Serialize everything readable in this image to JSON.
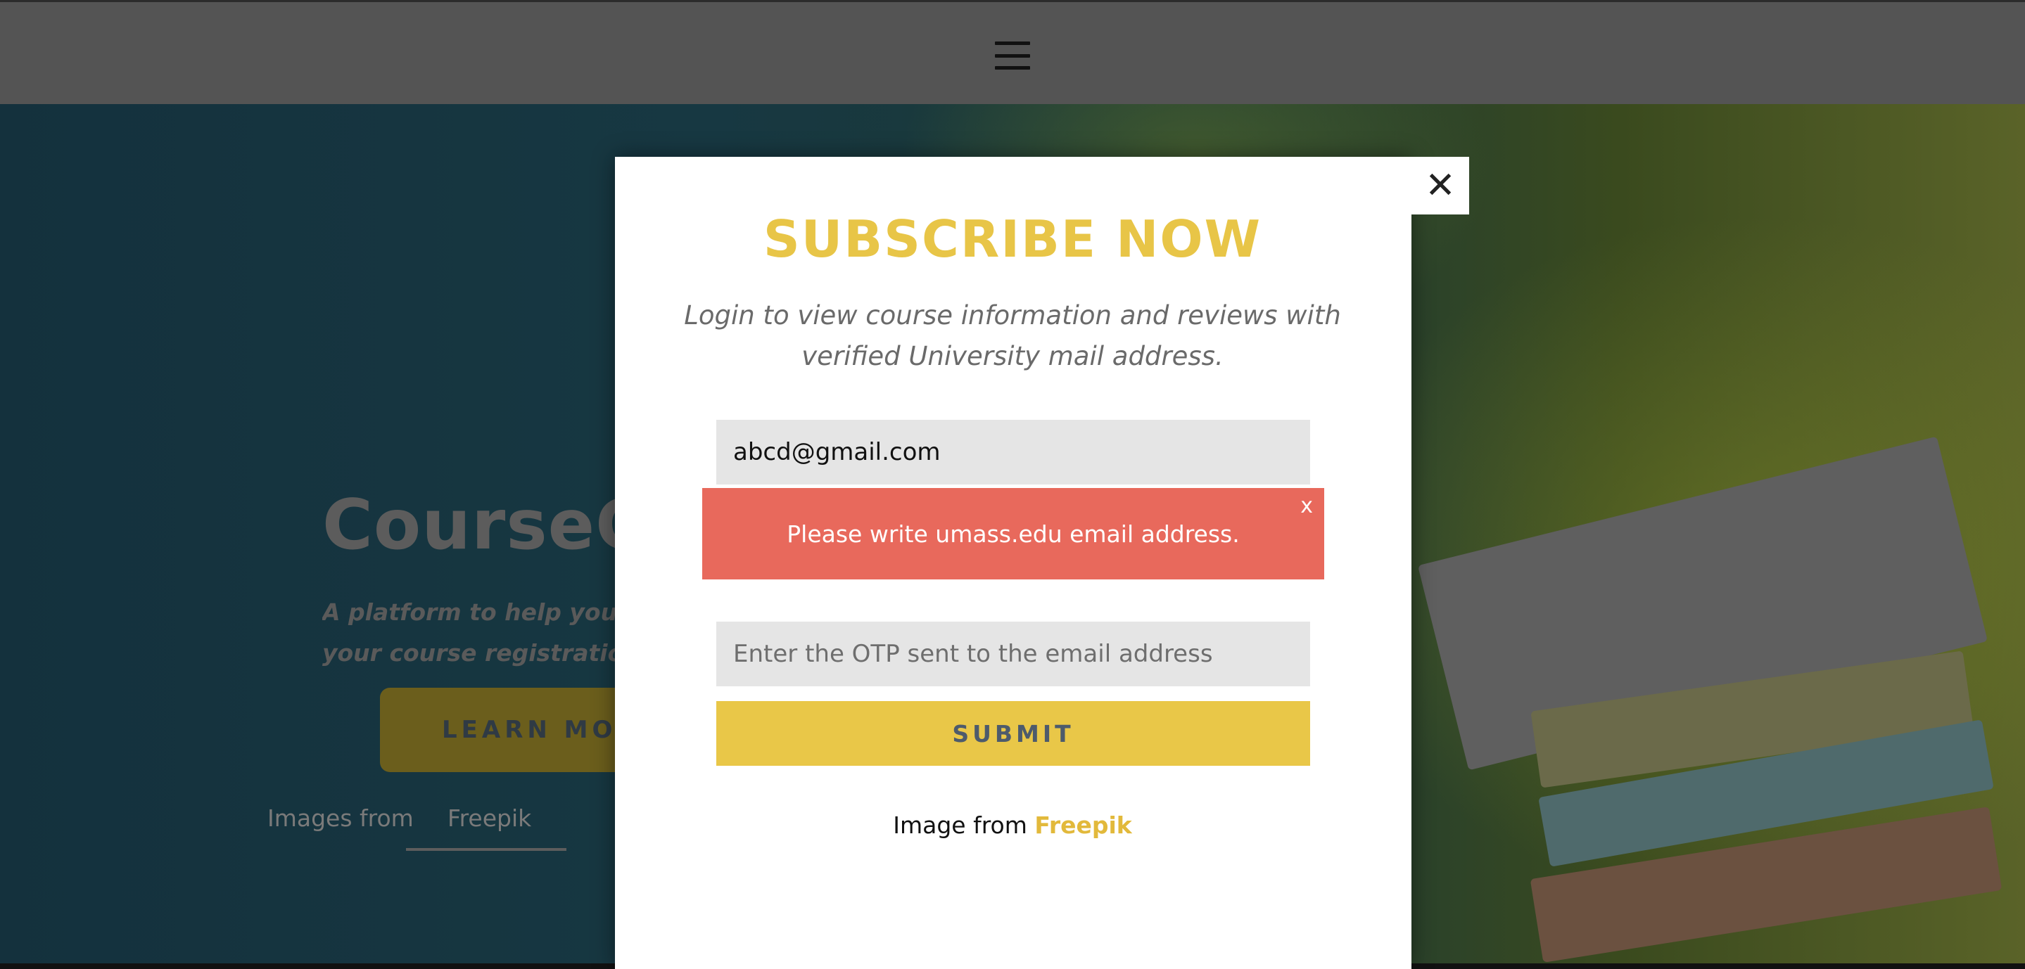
{
  "background": {
    "hero_title": "CourseGr",
    "hero_description_lines": [
      "A platform to help you bett",
      "your course registration at"
    ],
    "learn_more_label": "LEARN MORE",
    "images_from_label": "Images from",
    "freepik_label": "Freepik"
  },
  "modal": {
    "close_icon": "close-icon",
    "title": "SUBSCRIBE NOW",
    "subtitle_lines": [
      "Login to view course information and reviews with",
      "verified University mail address."
    ],
    "email_value": "abcd@gmail.com",
    "alert_message": "Please write umass.edu email address.",
    "alert_close_label": "x",
    "otp_placeholder": "Enter the OTP sent to the email address",
    "submit_label": "SUBMIT",
    "credit_prefix": "Image from",
    "credit_link": "Freepik"
  },
  "colors": {
    "accent_yellow": "#e9c748",
    "alert_red": "#e8695c",
    "topbar": "#545454"
  }
}
